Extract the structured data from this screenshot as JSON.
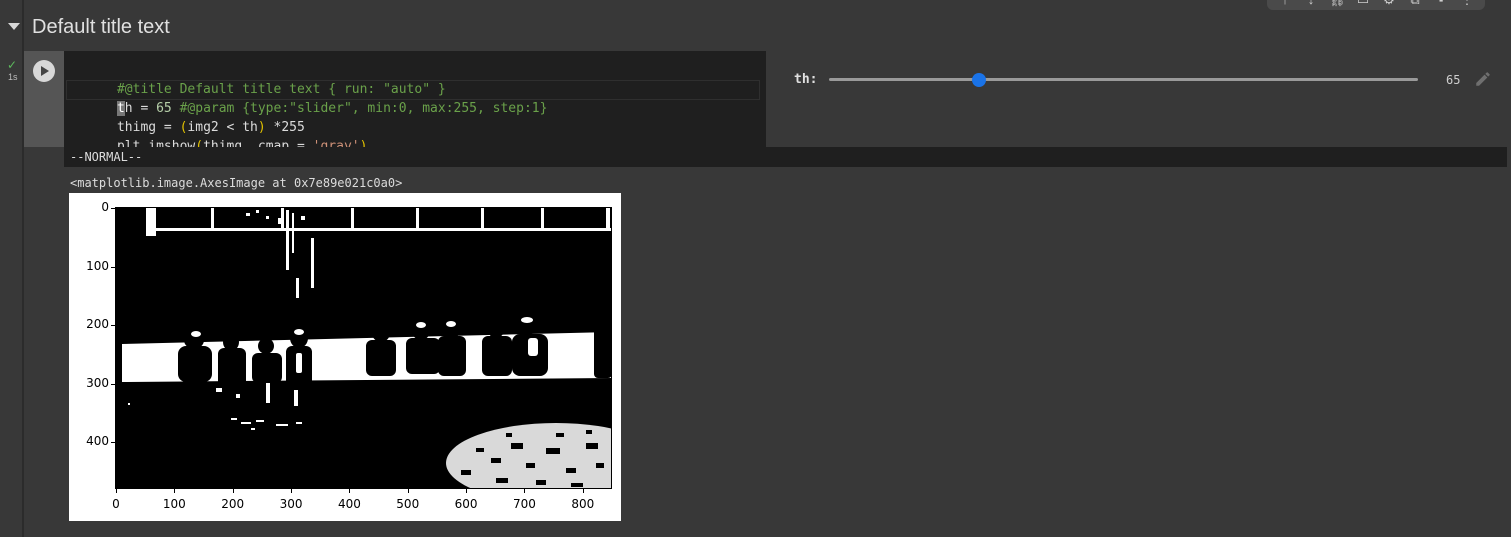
{
  "section": {
    "title": "Default title text"
  },
  "execution": {
    "status_icon": "check-icon",
    "time": "1s"
  },
  "code": {
    "line1": "#@title Default title text { run: \"auto\" }",
    "line2_cursor": "t",
    "line2_a": "h = ",
    "line2_num": "65",
    "line2_comment": " #@param {type:\"slider\", min:0, max:255, step:1}",
    "line3_a": "thimg = ",
    "line3_paren_open": "(",
    "line3_b": "img2 < th",
    "line3_paren_close": ")",
    "line3_c": " *255",
    "line4_a": "plt.imshow",
    "line4_paren_open": "(",
    "line4_b": "thimg, cmap = ",
    "line4_str": "'gray'",
    "line4_paren_close": ")"
  },
  "form": {
    "label": "th:",
    "value": "65",
    "min": 0,
    "max": 255,
    "step": 1,
    "accent": "#1a73e8"
  },
  "vim": {
    "status": "--NORMAL--"
  },
  "output": {
    "repr": "<matplotlib.image.AxesImage at 0x7e89e021c0a0>"
  },
  "plot": {
    "y_ticks": [
      "0",
      "100",
      "200",
      "300",
      "400"
    ],
    "x_ticks": [
      "0",
      "100",
      "200",
      "300",
      "400",
      "500",
      "600",
      "700",
      "800"
    ],
    "colormap": "gray"
  },
  "toolbar": {
    "icons": [
      "arrow-up-icon",
      "arrow-down-icon",
      "link-icon",
      "comment-icon",
      "gear-icon",
      "mirror-icon",
      "delete-icon",
      "more-icon"
    ]
  }
}
